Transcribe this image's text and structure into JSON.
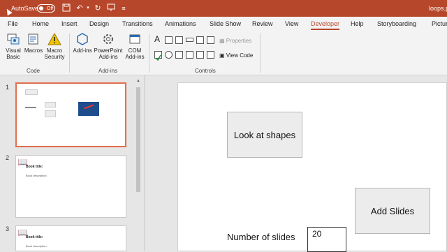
{
  "titlebar": {
    "autosave_label": "AutoSave",
    "autosave_state": "Off",
    "filename": "loops.p",
    "accent": "#b7472a"
  },
  "menu": {
    "tabs": [
      "File",
      "Home",
      "Insert",
      "Design",
      "Transitions",
      "Animations",
      "Slide Show",
      "Review",
      "View",
      "Developer",
      "Help",
      "Storyboarding",
      "Pictur"
    ],
    "active": "Developer"
  },
  "ribbon": {
    "code": {
      "label": "Code",
      "visual_basic": "Visual Basic",
      "macros": "Macros",
      "macro_security": "Macro Security"
    },
    "addins": {
      "label": "Add-ins",
      "addins": "Add-ins",
      "powerpoint_addins": "PowerPoint Add-ins",
      "com_addins": "COM Add-ins"
    },
    "controls": {
      "label": "Controls",
      "properties": "Properties",
      "view_code": "View Code"
    }
  },
  "thumbnails": {
    "slides": [
      {
        "number": "1",
        "selected": true
      },
      {
        "number": "2",
        "selected": false,
        "title": "Book title:",
        "subtitle": "Book description"
      },
      {
        "number": "3",
        "selected": false,
        "title": "Book title:",
        "subtitle": "Book description"
      }
    ]
  },
  "slide": {
    "look_button": "Look at shapes",
    "add_button": "Add Slides",
    "num_label": "Number of slides",
    "num_value": "20"
  }
}
